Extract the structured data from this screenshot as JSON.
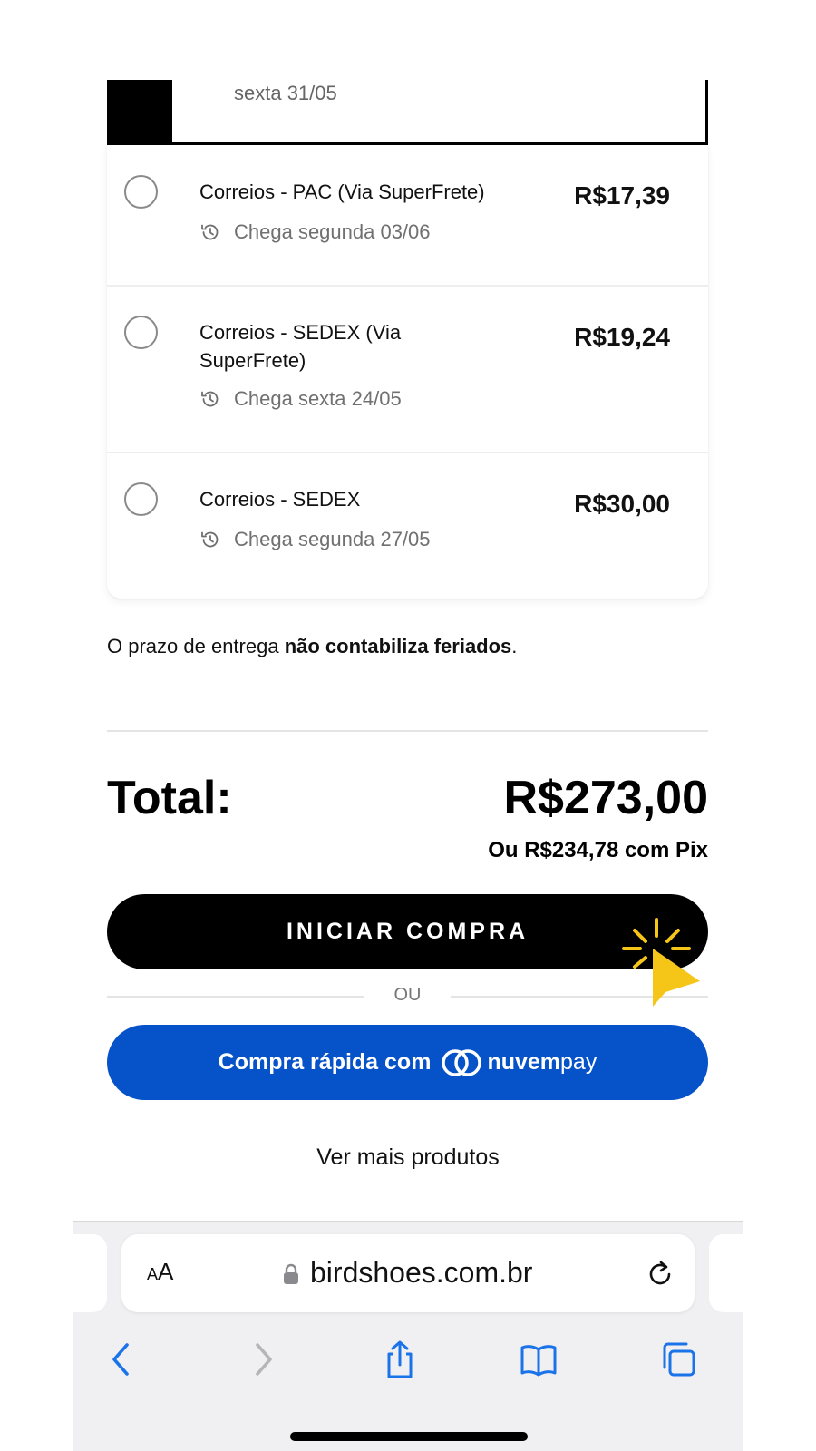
{
  "shipping": {
    "selected_option_date": "sexta 31/05",
    "options": [
      {
        "name": "Correios - PAC (Via SuperFrete)",
        "eta": "Chega segunda 03/06",
        "price": "R$17,39"
      },
      {
        "name": "Correios - SEDEX (Via SuperFrete)",
        "eta": "Chega sexta 24/05",
        "price": "R$19,24"
      },
      {
        "name": "Correios - SEDEX",
        "eta": "Chega segunda 27/05",
        "price": "R$30,00"
      }
    ],
    "note_prefix": "O prazo de entrega ",
    "note_bold": "não contabiliza feriados",
    "note_suffix": "."
  },
  "summary": {
    "total_label": "Total:",
    "total_value": "R$273,00",
    "pix_text": "Ou R$234,78 com Pix"
  },
  "actions": {
    "start_purchase": "INICIAR COMPRA",
    "or_text": "OU",
    "fast_buy_prefix": "Compra rápida com",
    "fast_buy_brand_a": "nuvem",
    "fast_buy_brand_b": "pay",
    "more_products": "Ver mais produtos"
  },
  "browser": {
    "text_size_small": "A",
    "text_size_large": "A",
    "url": "birdshoes.com.br",
    "accent_color": "#1a73e8"
  },
  "colors": {
    "primary_button": "#000000",
    "nuvempay_blue": "#0552c9",
    "cursor_yellow": "#f5c518"
  }
}
